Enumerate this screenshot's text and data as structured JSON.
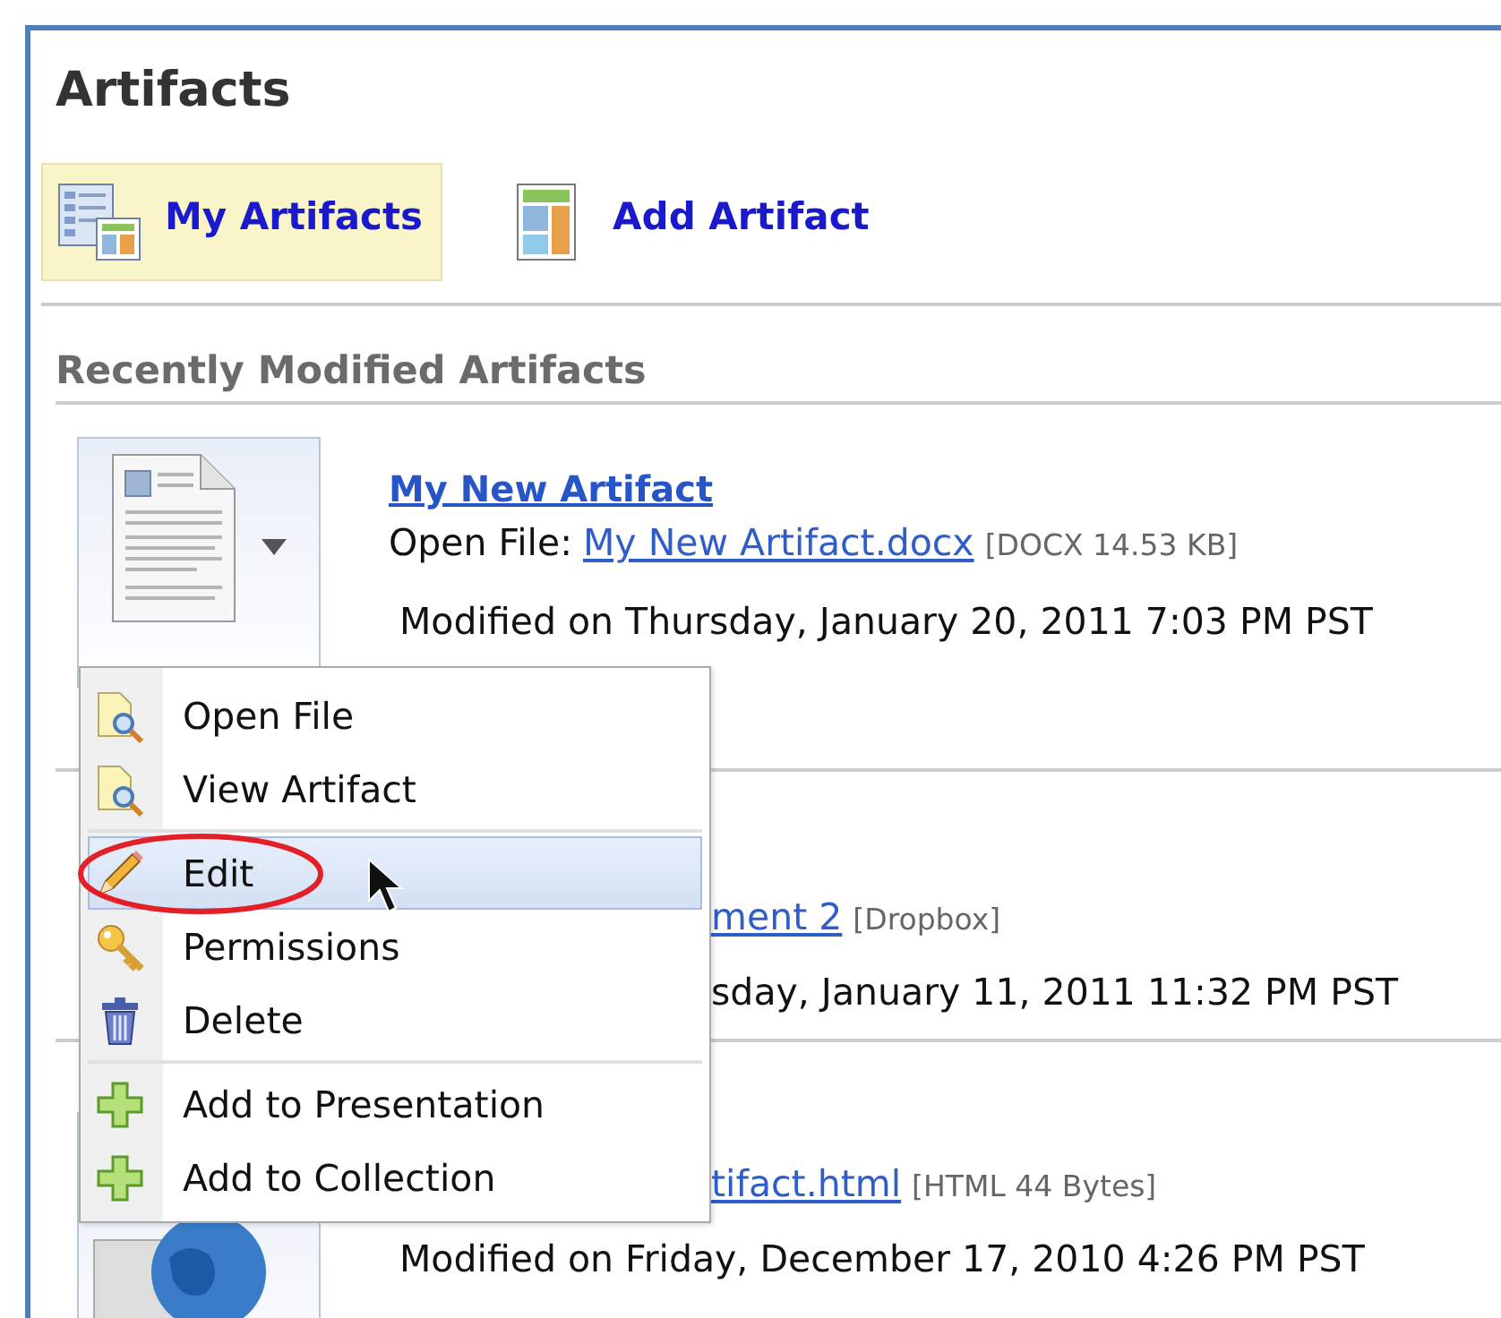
{
  "title": "Artifacts",
  "tabs": [
    {
      "label": "My Artifacts",
      "selected": true,
      "kind": "list"
    },
    {
      "label": "Add Artifact",
      "selected": false,
      "kind": "add"
    }
  ],
  "section": "Recently Modified Artifacts",
  "artifacts": [
    {
      "kind": "document",
      "title": "My New Artifact",
      "lines": [
        {
          "kind": "file",
          "prefix": "Open File:",
          "link": "My New Artifact.docx",
          "meta": "[DOCX  14.53 KB]",
          "covered": false
        },
        {
          "kind": "modified",
          "text": "Modified on Thursday, January 20, 2011 7:03 PM PST",
          "covered": false
        }
      ]
    },
    {
      "kind": "hidden",
      "lines": [
        {
          "kind": "file",
          "link": "ment 2",
          "meta": "[Dropbox]",
          "covered": true
        },
        {
          "kind": "modified",
          "text": "sday, January 11, 2011 11:32 PM PST",
          "covered": true
        }
      ]
    },
    {
      "kind": "web",
      "lines": [
        {
          "kind": "file",
          "link": "tifact.html",
          "meta": "[HTML  44 Bytes]",
          "covered": true
        },
        {
          "kind": "modified",
          "text": "Modified on Friday, December 17, 2010 4:26 PM PST",
          "covered": false
        }
      ]
    }
  ],
  "menu": {
    "groups": [
      [
        {
          "label": "Open File",
          "kind": "view",
          "selected": false,
          "circled": false
        },
        {
          "label": "View Artifact",
          "kind": "view",
          "selected": false,
          "circled": false
        }
      ],
      [
        {
          "label": "Edit",
          "kind": "edit",
          "selected": true,
          "circled": true
        },
        {
          "label": "Permissions",
          "kind": "permissions",
          "selected": false,
          "circled": false
        },
        {
          "label": "Delete",
          "kind": "delete",
          "selected": false,
          "circled": false
        }
      ],
      [
        {
          "label": "Add to Presentation",
          "kind": "add",
          "selected": false,
          "circled": false
        },
        {
          "label": "Add to Collection",
          "kind": "add",
          "selected": false,
          "circled": false
        }
      ]
    ]
  }
}
